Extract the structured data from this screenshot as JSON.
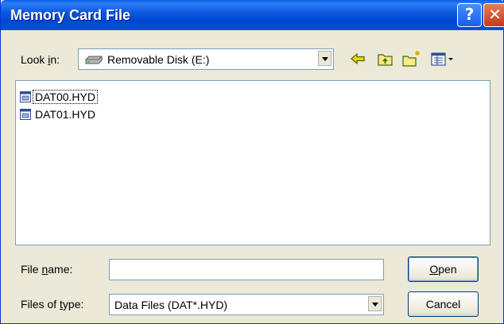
{
  "window": {
    "title": "Memory Card File",
    "help_glyph": "?",
    "close_glyph": "✕"
  },
  "look_in": {
    "label_pre": "Look ",
    "label_mnemonic": "i",
    "label_post": "n:",
    "value": "Removable Disk (E:)",
    "icon": "drive-icon"
  },
  "toolbar": {
    "icons": [
      "back-arrow-icon",
      "up-folder-icon",
      "new-folder-icon",
      "view-menu-icon"
    ]
  },
  "files": [
    {
      "name": "DAT00.HYD",
      "icon": "data-file-icon",
      "focused": true
    },
    {
      "name": "DAT01.HYD",
      "icon": "data-file-icon",
      "focused": false
    }
  ],
  "file_name": {
    "label_pre": "File ",
    "label_mnemonic": "n",
    "label_post": "ame:",
    "value": ""
  },
  "files_of_type": {
    "label_pre": "Files of ",
    "label_mnemonic": "t",
    "label_post": "ype:",
    "value": "Data Files (DAT*.HYD)"
  },
  "buttons": {
    "open_mnemonic": "O",
    "open_rest": "pen",
    "cancel": "Cancel"
  },
  "colors": {
    "title_bar": "#0a4fd8",
    "dialog_bg": "#ece9d8",
    "accent_icon": "#e6a800"
  }
}
